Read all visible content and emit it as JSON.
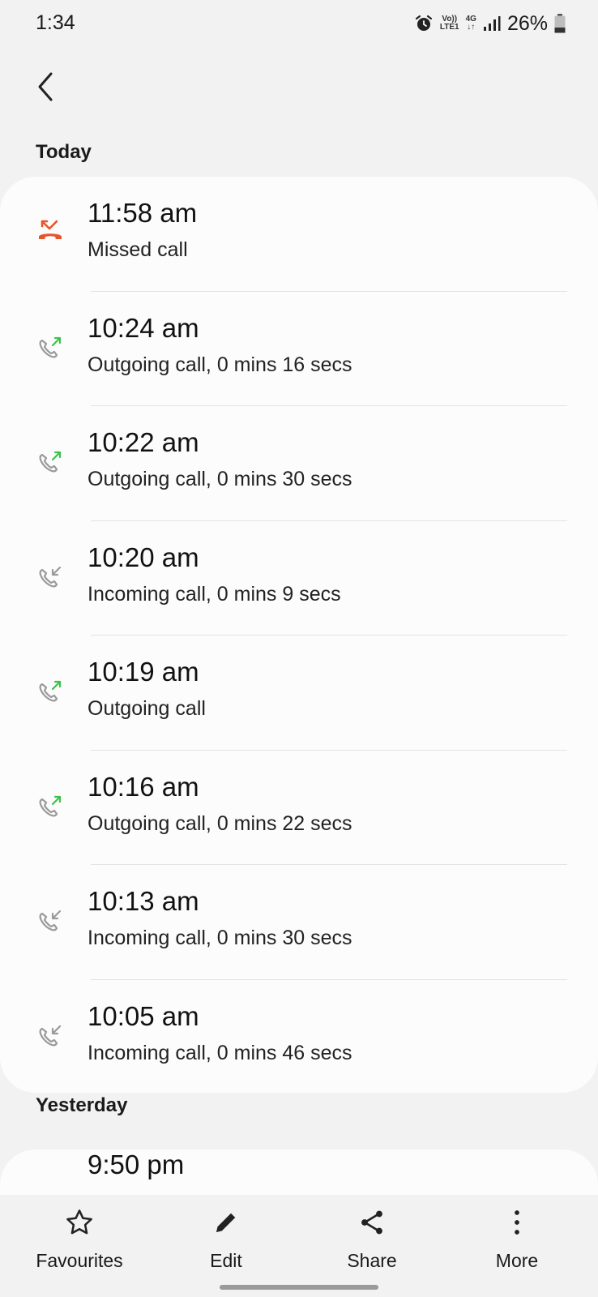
{
  "status_bar": {
    "time": "1:34",
    "volte_top": "Vo))",
    "volte_bottom": "LTE1",
    "network_top": "4G",
    "network_bottom": "↓↑",
    "battery": "26%",
    "icons": [
      "alarm-icon",
      "signal-icon",
      "battery-icon"
    ]
  },
  "header": {
    "back_icon": "back-arrow-icon"
  },
  "sections": [
    {
      "title": "Today",
      "calls": [
        {
          "time": "11:58 am",
          "description": "Missed call",
          "type": "missed"
        },
        {
          "time": "10:24 am",
          "description": "Outgoing call, 0 mins 16 secs",
          "type": "outgoing"
        },
        {
          "time": "10:22 am",
          "description": "Outgoing call, 0 mins 30 secs",
          "type": "outgoing"
        },
        {
          "time": "10:20 am",
          "description": "Incoming call, 0 mins 9 secs",
          "type": "incoming"
        },
        {
          "time": "10:19 am",
          "description": "Outgoing call",
          "type": "outgoing"
        },
        {
          "time": "10:16 am",
          "description": "Outgoing call, 0 mins 22 secs",
          "type": "outgoing"
        },
        {
          "time": "10:13 am",
          "description": "Incoming call, 0 mins 30 secs",
          "type": "incoming"
        },
        {
          "time": "10:05 am",
          "description": "Incoming call, 0 mins 46 secs",
          "type": "incoming"
        }
      ]
    },
    {
      "title": "Yesterday",
      "calls": [
        {
          "time": "9:50 pm",
          "description": "",
          "type": ""
        }
      ]
    }
  ],
  "bottom_nav": [
    {
      "label": "Favourites",
      "icon": "star-icon"
    },
    {
      "label": "Edit",
      "icon": "pencil-icon"
    },
    {
      "label": "Share",
      "icon": "share-icon"
    },
    {
      "label": "More",
      "icon": "more-vertical-icon"
    }
  ],
  "colors": {
    "missed": "#e8542c",
    "outgoing_arrow": "#3cc24a",
    "incoming_arrow": "#9a9a9a",
    "phone_gray": "#9a9a9a",
    "background": "#f2f2f2",
    "card": "#fcfcfc"
  }
}
